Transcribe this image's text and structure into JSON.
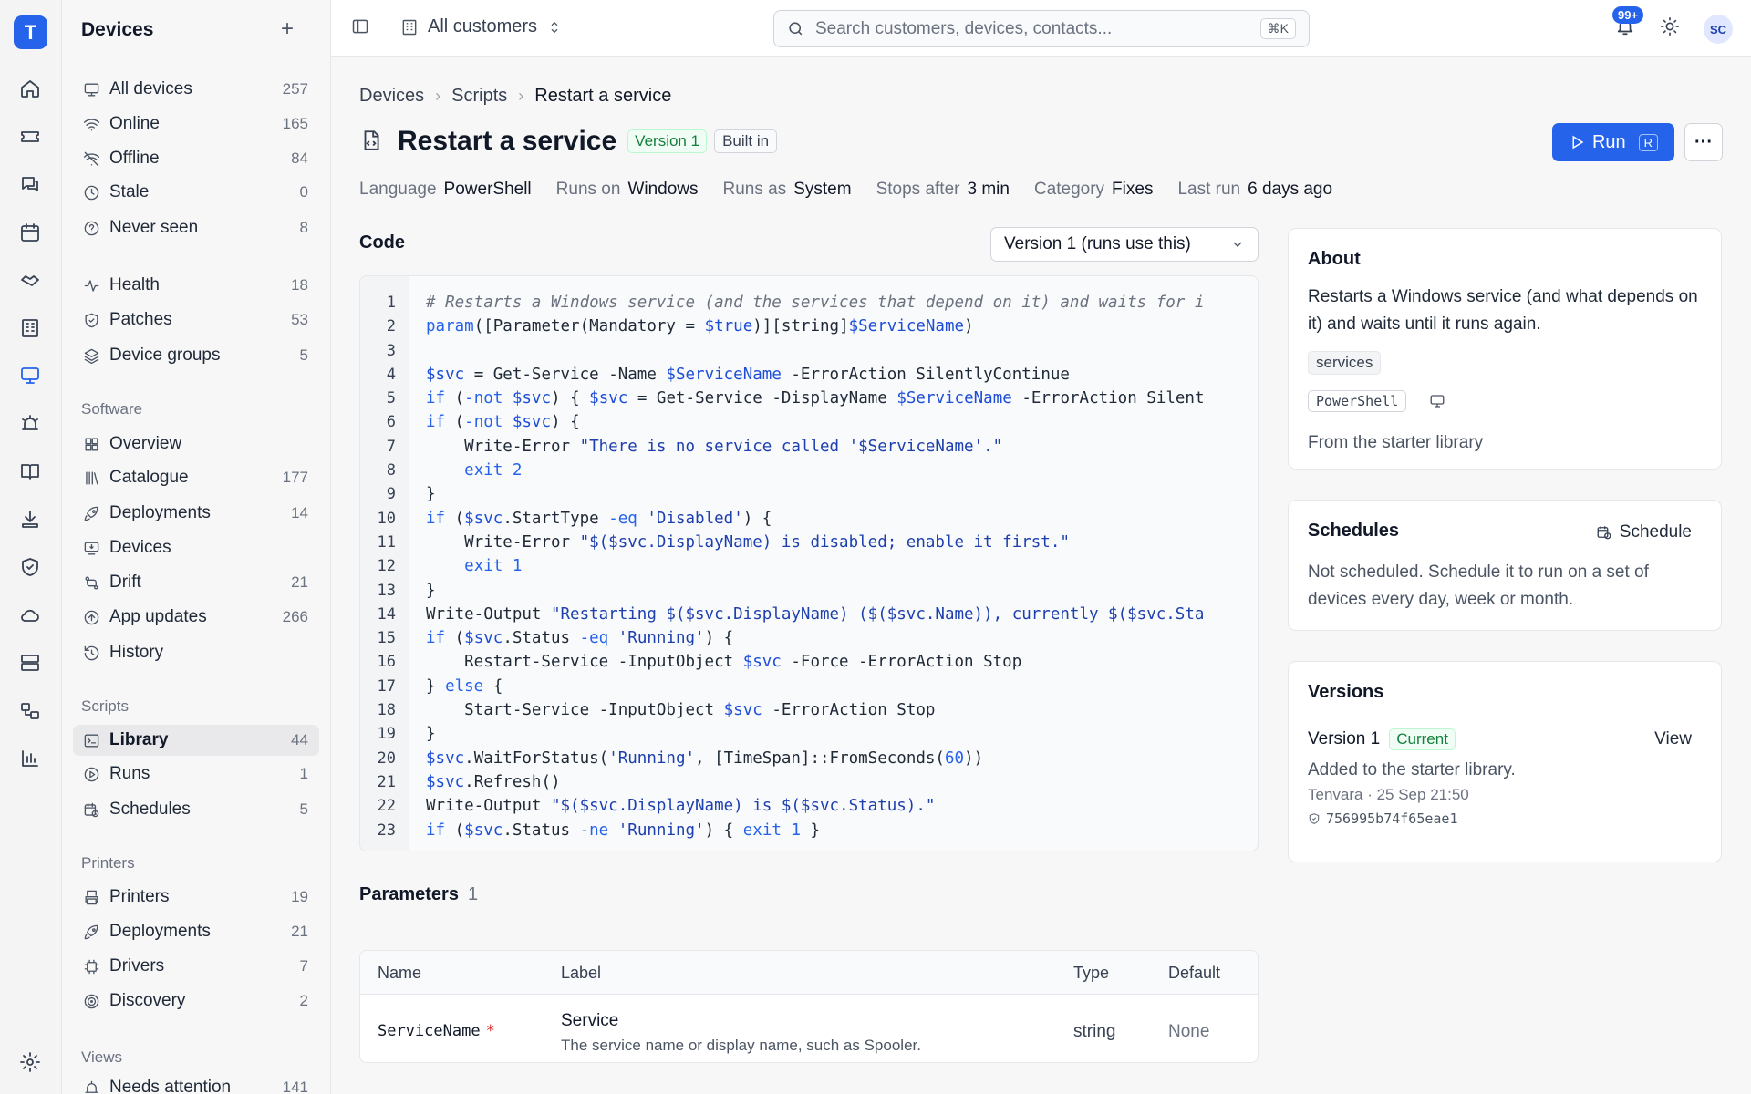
{
  "rail": {
    "logo": "T",
    "icons": [
      "home-icon",
      "ticket-icon",
      "chat-icon",
      "calendar-icon",
      "handshake-icon",
      "building-icon",
      "monitor-icon",
      "alarm-icon",
      "book-icon",
      "download-icon",
      "shield-icon",
      "cloud-icon",
      "server-icon",
      "flow-icon",
      "chart-icon",
      "settings-icon"
    ]
  },
  "sidebar": {
    "title": "Devices",
    "add": "+",
    "devices": [
      {
        "label": "All devices",
        "count": "257"
      },
      {
        "label": "Online",
        "count": "165"
      },
      {
        "label": "Offline",
        "count": "84"
      },
      {
        "label": "Stale",
        "count": "0"
      },
      {
        "label": "Never seen",
        "count": "8"
      }
    ],
    "health": [
      {
        "label": "Health",
        "count": "18"
      },
      {
        "label": "Patches",
        "count": "53"
      },
      {
        "label": "Device groups",
        "count": "5"
      }
    ],
    "software_title": "Software",
    "software": [
      {
        "label": "Overview",
        "count": ""
      },
      {
        "label": "Catalogue",
        "count": "177"
      },
      {
        "label": "Deployments",
        "count": "14"
      },
      {
        "label": "Devices",
        "count": ""
      },
      {
        "label": "Drift",
        "count": "21"
      },
      {
        "label": "App updates",
        "count": "266"
      },
      {
        "label": "History",
        "count": ""
      }
    ],
    "scripts_title": "Scripts",
    "scripts": [
      {
        "label": "Library",
        "count": "44"
      },
      {
        "label": "Runs",
        "count": "1"
      },
      {
        "label": "Schedules",
        "count": "5"
      }
    ],
    "printers_title": "Printers",
    "printers": [
      {
        "label": "Printers",
        "count": "19"
      },
      {
        "label": "Deployments",
        "count": "21"
      },
      {
        "label": "Drivers",
        "count": "7"
      },
      {
        "label": "Discovery",
        "count": "2"
      }
    ],
    "views_title": "Views",
    "views": [
      {
        "label": "Needs attention",
        "count": "141"
      }
    ]
  },
  "topbar": {
    "customers": "All customers",
    "search_placeholder": "Search customers, devices, contacts...",
    "search_kbd": "⌘K",
    "notif_badge": "99+",
    "avatar": "SC"
  },
  "breadcrumb": [
    "Devices",
    "Scripts",
    "Restart a service"
  ],
  "header": {
    "title": "Restart a service",
    "version_pill": "Version 1",
    "builtin_pill": "Built in",
    "run_label": "Run",
    "run_kbd": "R",
    "more": "···"
  },
  "meta": [
    {
      "key": "Language",
      "value": "PowerShell"
    },
    {
      "key": "Runs on",
      "value": "Windows"
    },
    {
      "key": "Runs as",
      "value": "System"
    },
    {
      "key": "Stops after",
      "value": "3 min"
    },
    {
      "key": "Category",
      "value": "Fixes"
    },
    {
      "key": "Last run",
      "value": "6 days ago"
    }
  ],
  "code": {
    "title": "Code",
    "version_select": "Version 1 (runs use this)",
    "lines": [
      "# Restarts a Windows service (and the services that depend on it) and waits for i",
      "param([Parameter(Mandatory = $true)][string]$ServiceName)",
      "",
      "$svc = Get-Service -Name $ServiceName -ErrorAction SilentlyContinue",
      "if (-not $svc) { $svc = Get-Service -DisplayName $ServiceName -ErrorAction Silent",
      "if (-not $svc) {",
      "    Write-Error \"There is no service called '$ServiceName'.\"",
      "    exit 2",
      "}",
      "if ($svc.StartType -eq 'Disabled') {",
      "    Write-Error \"$($svc.DisplayName) is disabled; enable it first.\"",
      "    exit 1",
      "}",
      "Write-Output \"Restarting $($svc.DisplayName) ($($svc.Name)), currently $($svc.Sta",
      "if ($svc.Status -eq 'Running') {",
      "    Restart-Service -InputObject $svc -Force -ErrorAction Stop",
      "} else {",
      "    Start-Service -InputObject $svc -ErrorAction Stop",
      "}",
      "$svc.WaitForStatus('Running', [TimeSpan]::FromSeconds(60))",
      "$svc.Refresh()",
      "Write-Output \"$($svc.DisplayName) is $($svc.Status).\"",
      "if ($svc.Status -ne 'Running') { exit 1 }"
    ]
  },
  "parameters": {
    "title": "Parameters",
    "count": "1",
    "headers": [
      "Name",
      "Label",
      "Type",
      "Default"
    ],
    "rows": [
      {
        "name": "ServiceName",
        "required": "*",
        "label": "Service",
        "desc": "The service name or display name, such as Spooler.",
        "type": "string",
        "default": "None"
      }
    ]
  },
  "about": {
    "title": "About",
    "text": "Restarts a Windows service (and what depends on it) and waits until it runs again.",
    "tag": "services",
    "lang_tag": "PowerShell",
    "source": "From the starter library"
  },
  "schedules": {
    "title": "Schedules",
    "button": "Schedule",
    "text": "Not scheduled. Schedule it to run on a set of devices every day, week or month."
  },
  "versions": {
    "title": "Versions",
    "name": "Version 1",
    "current": "Current",
    "view": "View",
    "note": "Added to the starter library.",
    "by": "Tenvara · 25 Sep 21:50",
    "hash": "756995b74f65eae1"
  },
  "colors": {
    "accent": "#2563eb",
    "success": "#15803d",
    "danger": "#dc2626"
  }
}
